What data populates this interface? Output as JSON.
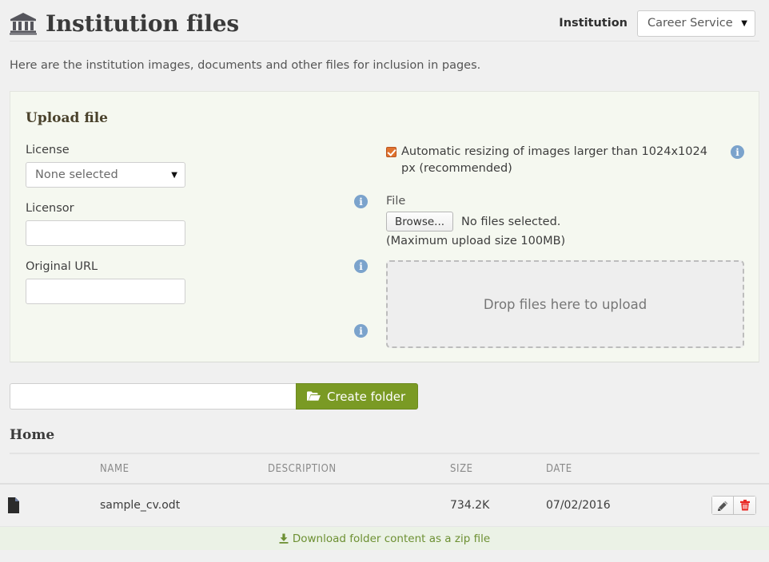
{
  "header": {
    "icon": "bank-institution-icon",
    "title": "Institution files",
    "institution_label": "Institution",
    "institution_value": "Career Service",
    "caret": "▼"
  },
  "intro": "Here are the institution images, documents and other files for inclusion in pages.",
  "upload": {
    "panel_title": "Upload file",
    "license_label": "License",
    "license_value": "None selected",
    "licensor_label": "Licensor",
    "licensor_value": "",
    "licensor_placeholder": "",
    "original_url_label": "Original URL",
    "original_url_value": "",
    "original_url_placeholder": "",
    "resize_checkbox_checked": true,
    "resize_text": "Automatic resizing of images larger than 1024x1024 px (recommended)",
    "file_label": "File",
    "browse_button": "Browse...",
    "no_files_text": "No files selected.",
    "max_upload_text": "(Maximum upload size 100MB)",
    "dropzone_text": "Drop files here to upload",
    "info_icon": "info-icon",
    "info_glyph": "i",
    "caret": "▼"
  },
  "create_folder": {
    "input_value": "",
    "input_placeholder": "",
    "button_label": "Create folder",
    "button_icon": "folder-open-icon"
  },
  "listing": {
    "breadcrumb": "Home",
    "columns": [
      "",
      "NAME",
      "DESCRIPTION",
      "SIZE",
      "DATE",
      ""
    ],
    "rows": [
      {
        "icon": "document-icon",
        "name": "sample_cv.odt",
        "description": "",
        "size": "734.2K",
        "date": "07/02/2016",
        "edit_label": "pencil-icon",
        "delete_label": "trash-icon"
      }
    ],
    "zip_link": "Download folder content as a zip file",
    "zip_icon": "download-icon"
  },
  "colors": {
    "page_bg": "#f0f0f0",
    "panel_bg": "#f5f8f0",
    "accent_green": "#7a9a24",
    "link_green": "#6d9033",
    "zip_bar_bg": "#ebf2e6",
    "info_blue": "#7ba3cc",
    "checkbox_orange": "#e0732f",
    "delete_red": "#e8231f"
  }
}
